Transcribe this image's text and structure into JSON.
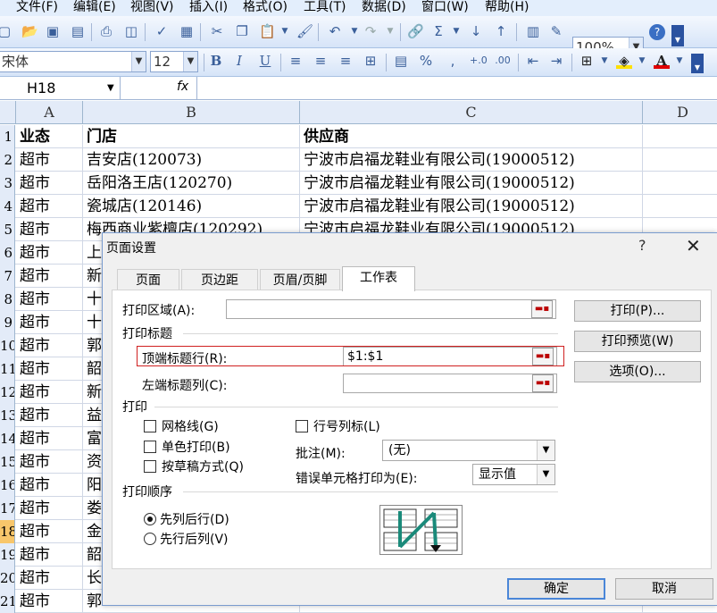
{
  "menu": [
    "文件(F)",
    "编辑(E)",
    "视图(V)",
    "插入(I)",
    "格式(O)",
    "工具(T)",
    "数据(D)",
    "窗口(W)",
    "帮助(H)"
  ],
  "toolbar": {
    "zoom": "100%",
    "font": "宋体",
    "size": "12",
    "bold": "B",
    "italic": "I",
    "underline": "U",
    "percent": "%",
    "comma": ","
  },
  "formula": {
    "cell": "H18",
    "fx": "fx",
    "value": ""
  },
  "columns": [
    "A",
    "B",
    "C",
    "D"
  ],
  "header_row": {
    "num": "1",
    "a": "业态",
    "b": "门店",
    "c": "供应商"
  },
  "rows": [
    {
      "num": "2",
      "a": "超市",
      "b": "吉安店(120073)",
      "c": "宁波市启福龙鞋业有限公司(19000512)"
    },
    {
      "num": "3",
      "a": "超市",
      "b": "岳阳洛王店(120270)",
      "c": "宁波市启福龙鞋业有限公司(19000512)"
    },
    {
      "num": "4",
      "a": "超市",
      "b": "瓷城店(120146)",
      "c": "宁波市启福龙鞋业有限公司(19000512)"
    },
    {
      "num": "5",
      "a": "超市",
      "b": "梅西商业紫檀店(120292)",
      "c": "宁波市启福龙鞋业有限公司(19000512)"
    },
    {
      "num": "6",
      "a": "超市",
      "b": "上",
      "c": ""
    },
    {
      "num": "7",
      "a": "超市",
      "b": "新",
      "c": ""
    },
    {
      "num": "8",
      "a": "超市",
      "b": "十",
      "c": ""
    },
    {
      "num": "9",
      "a": "超市",
      "b": "十",
      "c": ""
    },
    {
      "num": "10",
      "a": "超市",
      "b": "郭",
      "c": ""
    },
    {
      "num": "11",
      "a": "超市",
      "b": "韶",
      "c": ""
    },
    {
      "num": "12",
      "a": "超市",
      "b": "新",
      "c": ""
    },
    {
      "num": "13",
      "a": "超市",
      "b": "益",
      "c": ""
    },
    {
      "num": "14",
      "a": "超市",
      "b": "富",
      "c": ""
    },
    {
      "num": "15",
      "a": "超市",
      "b": "资",
      "c": ""
    },
    {
      "num": "16",
      "a": "超市",
      "b": "阳",
      "c": ""
    },
    {
      "num": "17",
      "a": "超市",
      "b": "娄",
      "c": ""
    },
    {
      "num": "18",
      "a": "超市",
      "b": "金",
      "c": ""
    },
    {
      "num": "19",
      "a": "超市",
      "b": "韶",
      "c": ""
    },
    {
      "num": "20",
      "a": "超市",
      "b": "长",
      "c": ""
    },
    {
      "num": "21",
      "a": "超市",
      "b": "郭",
      "c": ""
    }
  ],
  "dialog": {
    "title": "页面设置",
    "help": "?",
    "close": "✕",
    "tabs": [
      "页面",
      "页边距",
      "页眉/页脚",
      "工作表"
    ],
    "print_area_label": "打印区域(A):",
    "print_titles_group": "打印标题",
    "top_rows_label": "顶端标题行(R):",
    "top_rows_value": "$1:$1",
    "left_cols_label": "左端标题列(C):",
    "print_group": "打印",
    "gridlines": "网格线(G)",
    "mono": "单色打印(B)",
    "draft": "按草稿方式(Q)",
    "row_col_headers": "行号列标(L)",
    "comments_label": "批注(M):",
    "comments_value": "(无)",
    "errors_label": "错误单元格打印为(E):",
    "errors_value": "显示值",
    "order_group": "打印顺序",
    "down_then_over": "先列后行(D)",
    "over_then_down": "先行后列(V)",
    "print_btn": "打印(P)...",
    "preview_btn": "打印预览(W)",
    "options_btn": "选项(O)...",
    "ok_btn": "确定",
    "cancel_btn": "取消"
  }
}
